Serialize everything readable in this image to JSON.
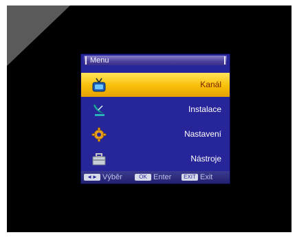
{
  "menu": {
    "title": "Menu",
    "items": [
      {
        "label": "Kanál",
        "icon": "tv-icon",
        "selected": true
      },
      {
        "label": "Instalace",
        "icon": "satellite-dish-icon",
        "selected": false
      },
      {
        "label": "Nastavení",
        "icon": "gear-icon",
        "selected": false
      },
      {
        "label": "Nástroje",
        "icon": "toolbox-icon",
        "selected": false
      }
    ]
  },
  "footer": {
    "select_key": "◄►",
    "select_label": "Výběr",
    "enter_key": "OK",
    "enter_label": "Enter",
    "exit_key": "EXIT",
    "exit_label": "Exit"
  },
  "colors": {
    "menu_bg": "#27259a",
    "selected_bg": "#f8bf08",
    "screen_bg": "#000000"
  }
}
